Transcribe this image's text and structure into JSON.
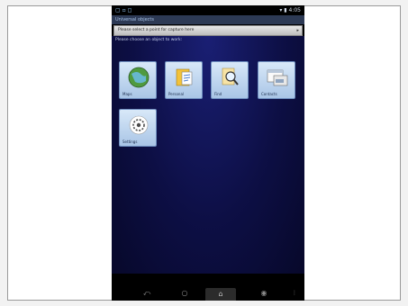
{
  "status_bar": {
    "left": "▢ ▫ ◻",
    "right": "▾ ▮ 4:05"
  },
  "app": {
    "title": "Universal objects",
    "dropdown_label": "Please select a point for capture here",
    "prompt": "Please choose an object to work:"
  },
  "tiles": [
    {
      "icon": "globe-icon",
      "label": "Maps"
    },
    {
      "icon": "folder-icon",
      "label": "Personal"
    },
    {
      "icon": "search-icon",
      "label": "Find"
    },
    {
      "icon": "dialog-icon",
      "label": "Contacts"
    },
    {
      "icon": "settings-icon",
      "label": "Settings"
    }
  ],
  "nav": {
    "back_icon": "back-icon",
    "home_icon": "home-icon",
    "recents_icon": "recents-icon",
    "menu_icon": "menu-icon"
  }
}
